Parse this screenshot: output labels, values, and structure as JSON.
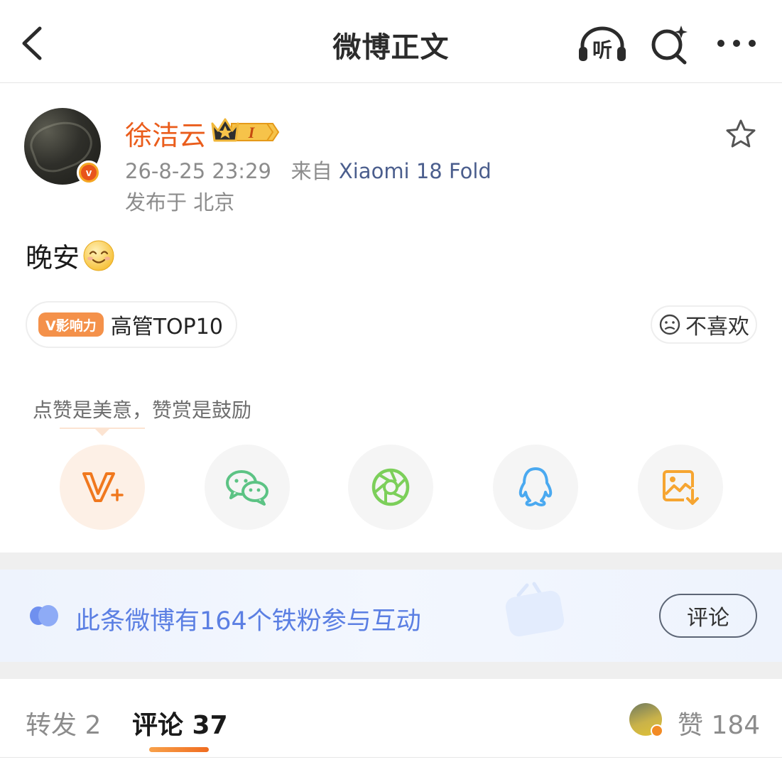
{
  "header": {
    "title": "微博正文",
    "listen_label": "听"
  },
  "author": {
    "name": "徐洁云",
    "member_level": "I",
    "verified_mark": "v",
    "timestamp": "26-8-25 23:29",
    "source_prefix": "来自",
    "source": "Xiaomi 18 Fold",
    "location": "发布于 北京"
  },
  "post": {
    "text": "晚安",
    "emoji": "smiling-face-emoji"
  },
  "influence": {
    "tag": "V影响力",
    "label": "高管TOP10"
  },
  "dislike": {
    "label": "不喜欢"
  },
  "share": {
    "tip": "点赞是美意，赞赏是鼓励",
    "items": [
      {
        "name": "reward-v-plus",
        "color": "#f0781e"
      },
      {
        "name": "wechat",
        "color": "#5cc384"
      },
      {
        "name": "wechat-moments",
        "color": "#7ccf5a"
      },
      {
        "name": "qq",
        "color": "#4aa9f0"
      },
      {
        "name": "save-image",
        "color": "#f6a531"
      }
    ]
  },
  "fans": {
    "text": "此条微博有164个铁粉参与互动",
    "button": "评论"
  },
  "tabs": {
    "repost": "转发 2",
    "comment": "评论 37",
    "likes": "赞 184"
  },
  "colors": {
    "accent_orange": "#ea5d1c",
    "link_blue": "#4b5e8d",
    "fans_blue": "#5b7fe3"
  }
}
